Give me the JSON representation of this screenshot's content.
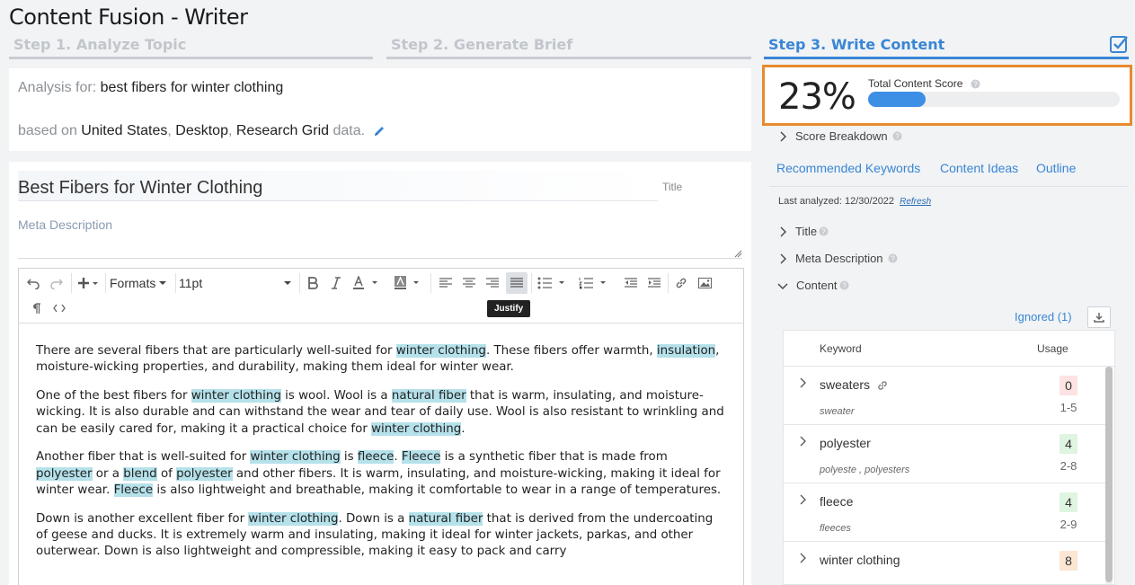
{
  "app": {
    "title": "Content Fusion - Writer"
  },
  "steps": [
    {
      "label": "Step 1. Analyze Topic"
    },
    {
      "label": "Step 2. Generate Brief"
    },
    {
      "label": "Step 3. Write Content"
    }
  ],
  "analysis": {
    "prefix": "Analysis for:",
    "topic": "best fibers for winter clothing",
    "based_on": "based on",
    "country": "United States",
    "comma1": ",",
    "device": "Desktop",
    "comma2": ",",
    "source": "Research Grid",
    "suffix": "data."
  },
  "editor": {
    "title_value": "Best Fibers for Winter Clothing",
    "title_tag": "Title",
    "meta_placeholder": "Meta Description",
    "toolbar": {
      "formats_label": "Formats",
      "font_size": "11pt",
      "tooltip": "Justify"
    },
    "paragraphs": [
      [
        {
          "t": "There are several fibers that are particularly well-suited for "
        },
        {
          "t": "winter clothing",
          "hl": true
        },
        {
          "t": ". These fibers offer warmth, "
        },
        {
          "t": "insulation",
          "hl": true
        },
        {
          "t": ", moisture-wicking properties, and durability, making them ideal for winter wear."
        }
      ],
      [
        {
          "t": "One of the best fibers for "
        },
        {
          "t": "winter clothing",
          "hl": true
        },
        {
          "t": " is wool. Wool is a "
        },
        {
          "t": "natural fiber",
          "hl": true
        },
        {
          "t": " that is warm, insulating, and moisture-wicking. It is also durable and can withstand the wear and tear of daily use. Wool is also resistant to wrinkling and can be easily cared for, making it a practical choice for "
        },
        {
          "t": "winter clothing",
          "hl": true
        },
        {
          "t": "."
        }
      ],
      [
        {
          "t": "Another fiber that is well-suited for "
        },
        {
          "t": "winter clothing",
          "hl": true
        },
        {
          "t": " is "
        },
        {
          "t": "fleece",
          "hl": true
        },
        {
          "t": ". "
        },
        {
          "t": "Fleece",
          "hl": true
        },
        {
          "t": " is a synthetic fiber that is made from "
        },
        {
          "t": "polyester",
          "hl": true
        },
        {
          "t": " or a "
        },
        {
          "t": "blend",
          "hl": true
        },
        {
          "t": " of "
        },
        {
          "t": "polyester",
          "hl": true
        },
        {
          "t": " and other fibers. It is warm, insulating, and moisture-wicking, making it ideal for winter wear. "
        },
        {
          "t": "Fleece",
          "hl": true
        },
        {
          "t": " is also lightweight and breathable, making it comfortable to wear in a range of temperatures."
        }
      ],
      [
        {
          "t": "Down is another excellent fiber for "
        },
        {
          "t": "winter clothing",
          "hl": true
        },
        {
          "t": ". Down is a "
        },
        {
          "t": "natural fiber",
          "hl": true
        },
        {
          "t": " that is derived from the undercoating of geese and ducks. It is extremely warm and insulating, making it ideal for winter jackets, parkas, and other outerwear. Down is also lightweight and compressible, making it easy to pack and carry"
        }
      ]
    ]
  },
  "score": {
    "percent_label": "23%",
    "percent_value": 0.23,
    "label": "Total Content Score",
    "fill_color": "#3d8ee5",
    "highlight_border": "#e88a2e"
  },
  "sidebar": {
    "score_breakdown": "Score Breakdown",
    "tabs": [
      "Recommended Keywords",
      "Content Ideas",
      "Outline"
    ],
    "last_analyzed": "Last analyzed: 12/30/2022",
    "refresh": "Refresh",
    "sections": [
      "Title",
      "Meta Description",
      "Content"
    ],
    "ignored": "Ignored (1)",
    "table": {
      "headers": [
        "Keyword",
        "Usage"
      ],
      "rows": [
        {
          "keyword": "sweaters",
          "variants": "sweater",
          "usage": "0",
          "range": "1-5",
          "status": "red",
          "has_link": true
        },
        {
          "keyword": "polyester",
          "variants": "polyeste ,  polyesters",
          "usage": "4",
          "range": "2-8",
          "status": "green",
          "has_link": false
        },
        {
          "keyword": "fleece",
          "variants": "fleeces",
          "usage": "4",
          "range": "2-9",
          "status": "green",
          "has_link": false
        },
        {
          "keyword": "winter clothing",
          "variants": "",
          "usage": "8",
          "range": "",
          "status": "orange",
          "has_link": false
        }
      ]
    }
  }
}
